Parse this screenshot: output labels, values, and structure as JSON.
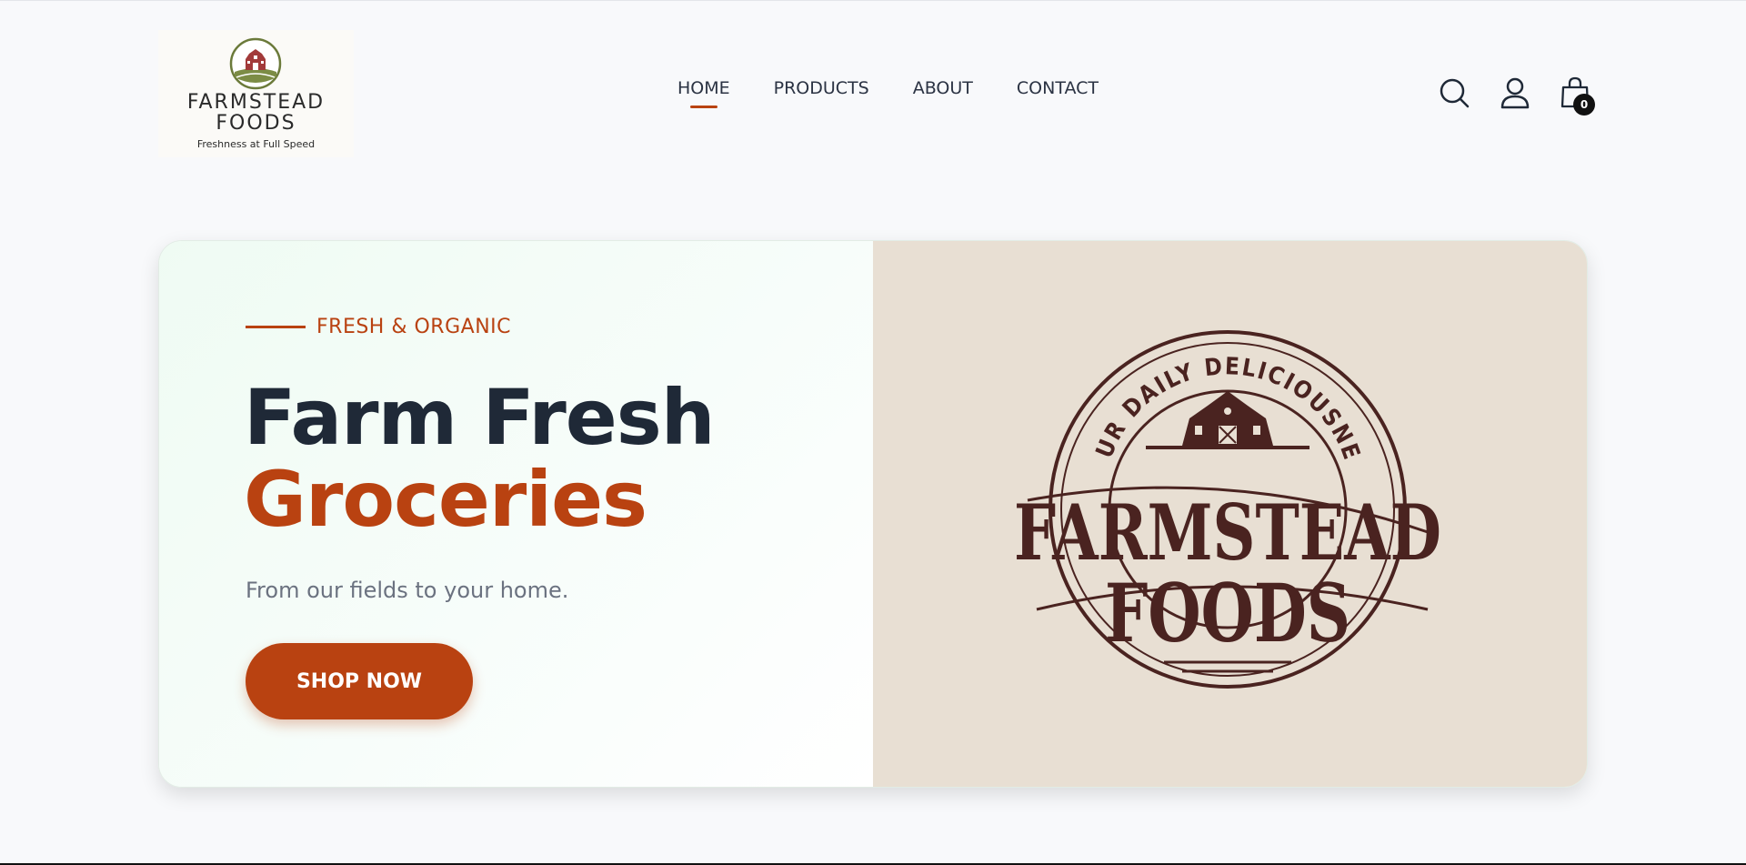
{
  "header": {
    "logo": {
      "name_line1": "FARMSTEAD",
      "name_line2": "FOODS",
      "tagline": "Freshness at Full Speed"
    },
    "nav": [
      {
        "label": "HOME",
        "active": true
      },
      {
        "label": "PRODUCTS",
        "active": false
      },
      {
        "label": "ABOUT",
        "active": false
      },
      {
        "label": "CONTACT",
        "active": false
      }
    ],
    "icons": [
      "search-icon",
      "user-icon",
      "shopping-bag-icon"
    ],
    "cart_count": "0"
  },
  "hero": {
    "eyebrow": "FRESH & ORGANIC",
    "title_line1": "Farm Fresh",
    "title_line2": "Groceries",
    "subtitle": "From our fields to your home.",
    "cta_label": "SHOP NOW",
    "emblem": {
      "arc_text": "YOUR DAILY DELICIOUSNESS",
      "word1": "FARMSTEAD",
      "word2": "FOODS"
    }
  },
  "colors": {
    "accent": "#b94211",
    "heading": "#1f2937",
    "emblem_brown": "#4a2320",
    "emblem_bg": "#e8dfd3"
  }
}
